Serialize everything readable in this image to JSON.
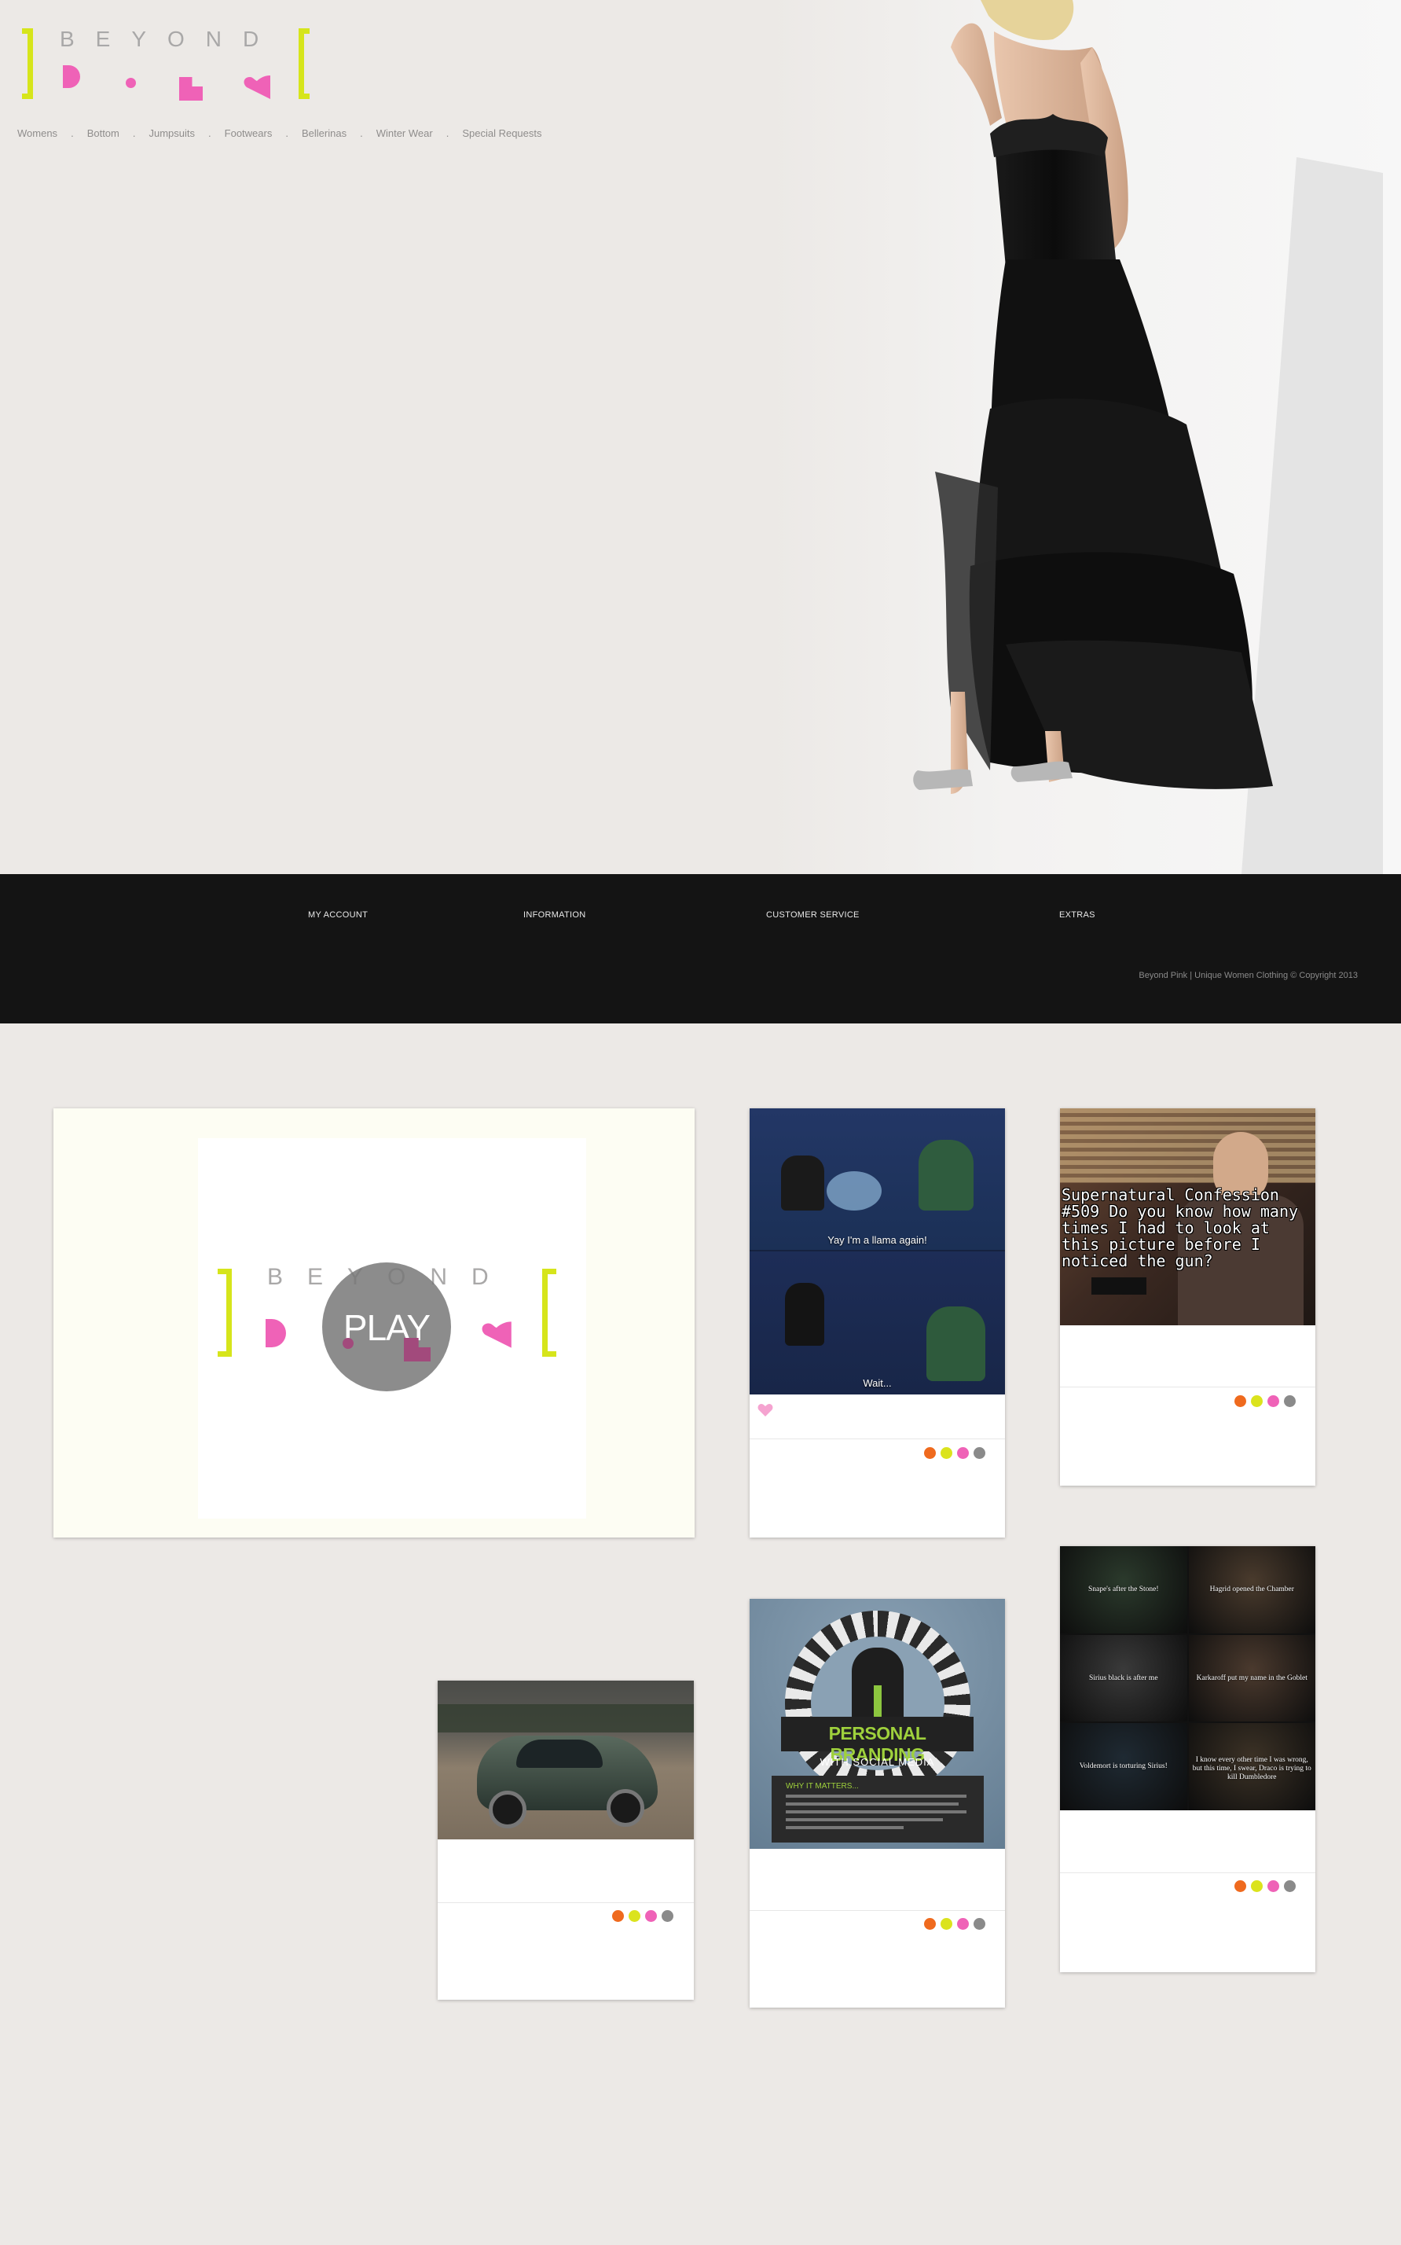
{
  "brand": {
    "name_top": "BEYOND",
    "colors": {
      "pink": "#ef62b7",
      "lime": "#d6e51b"
    }
  },
  "nav": {
    "items": [
      "Womens",
      "Bottom",
      "Jumpsuits",
      "Footwears",
      "Bellerinas",
      "Winter Wear",
      "Special Requests"
    ],
    "separator": "."
  },
  "footer": {
    "links": [
      "MY ACCOUNT",
      "INFORMATION",
      "CUSTOMER SERVICE",
      "EXTRAS"
    ],
    "copyright": "Beyond Pink | Unique Women Clothing © Copyright 2013"
  },
  "video": {
    "play_label": "PLAY",
    "brand_word": "BEYOND"
  },
  "cards": {
    "llama": {
      "caption_top": "Yay I'm a llama again!",
      "caption_bottom": "Wait..."
    },
    "supernatural": {
      "text": "Supernatural Confession #509 Do you know how many times I had to look at this picture before I noticed the gun?"
    },
    "branding": {
      "title": "PERSONAL BRANDING",
      "subtitle": "WITH SOCIAL MEDIA",
      "section": "WHY IT MATTERS..."
    },
    "potter": {
      "captions": [
        "Snape's after the Stone!",
        "Hagrid opened the Chamber",
        "Sirius black is after me",
        "Karkaroff put my name in the Goblet",
        "Voldemort is torturing Sirius!",
        "I know every other time I was wrong, but this time, I swear, Draco is trying to kill Dumbledore"
      ]
    }
  },
  "dot_colors": [
    "#ef6a1e",
    "#dbe31d",
    "#ef62b7",
    "#8a8a8a"
  ],
  "like_icon": "heart-icon"
}
